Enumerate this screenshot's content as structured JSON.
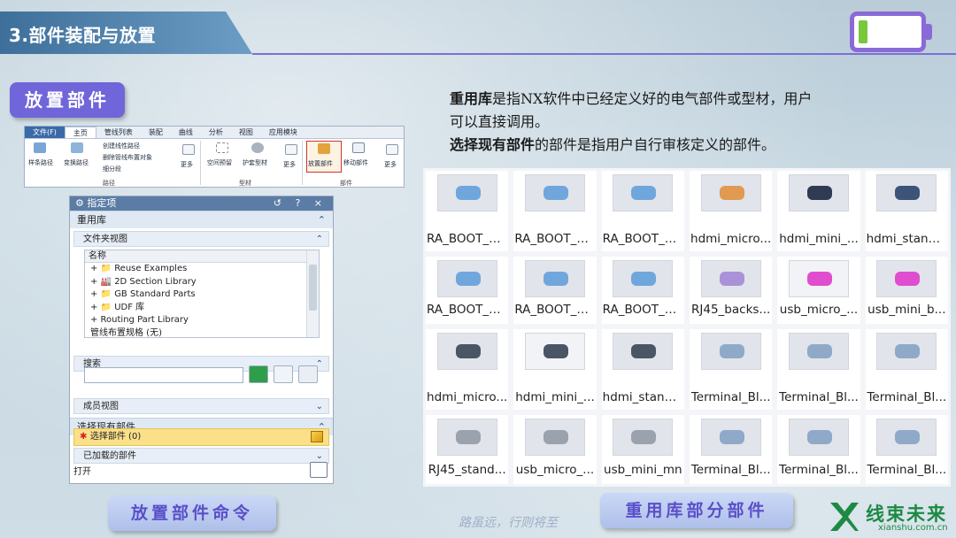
{
  "header": {
    "title": "3.部件装配与放置"
  },
  "badges": {
    "placement_title": "放置部件",
    "place_command": "放置部件命令",
    "reuse_parts": "重用库部分部件"
  },
  "motto": "路虽远，行则将至",
  "ribbon": {
    "tabs": [
      "文件(F)",
      "主页",
      "管线列表",
      "装配",
      "曲线",
      "分析",
      "视图",
      "应用模块"
    ],
    "active_tab": "主页",
    "items": {
      "spline_path": "样条路径",
      "transform_path": "变换路径",
      "create_linear_path": "创建线性路径",
      "delete_pipe_objects": "删除管线布置对象",
      "subdivide": "细分段",
      "more1": "更多",
      "space_reserve": "空间预留",
      "cover_material": "护套型材",
      "more2": "更多",
      "place_part": "放置部件",
      "move_part": "移动部件",
      "more3": "更多"
    },
    "groups": {
      "path": "路径",
      "profile": "型材",
      "part": "部件"
    }
  },
  "panel": {
    "title": "指定项",
    "controls": "↺ ? ×",
    "reuse_library": "重用库",
    "folder_view": "文件夹视图",
    "tree_header": "名称",
    "tree_rows": [
      "+ 📁 Reuse Examples",
      "+ 🏭 2D Section Library",
      "+ 📁 GB Standard Parts",
      "+ 📁 UDF 库",
      "+ Routing Part Library",
      "  管线布置规格 (无)"
    ],
    "search": "搜索",
    "member_view": "成员视图",
    "select_existing": "选择现有部件",
    "select_part": "选择部件 (0)",
    "loaded_parts": "已加载的部件",
    "open": "打开"
  },
  "description": {
    "line1_bold": "重用库",
    "line1_rest": "是指NX软件中已经定义好的电气部件或型材，用户",
    "line2": "可以直接调用。",
    "line3_bold": "选择现有部件",
    "line3_rest": "的部件是指用户自行审核定义的部件。"
  },
  "gallery": [
    [
      "RA_BOOT_1...",
      "RA_BOOT_1...",
      "RA_BOOT_1...",
      "hdmi_micro...",
      "hdmi_mini_...",
      "hdmi_stand..."
    ],
    [
      "RA_BOOT_1...",
      "RA_BOOT_1...",
      "RA_BOOT_2...",
      "RJ45_backs...",
      "usb_micro_...",
      "usb_mini_b..."
    ],
    [
      "hdmi_micro...",
      "hdmi_mini_...",
      "hdmi_stand...",
      "Terminal_Bl...",
      "Terminal_Bl...",
      "Terminal_Bl..."
    ],
    [
      "RJ45_stand...",
      "usb_micro_...",
      "usb_mini_mn",
      "Terminal_Bl...",
      "Terminal_Bl...",
      "Terminal_Bl..."
    ]
  ],
  "logo": {
    "name": "线束未来",
    "url": "xianshu.com.cn"
  },
  "colors": {
    "accent": "#7065d9",
    "header": "#3d6f9a",
    "logo": "#1d8a44"
  }
}
